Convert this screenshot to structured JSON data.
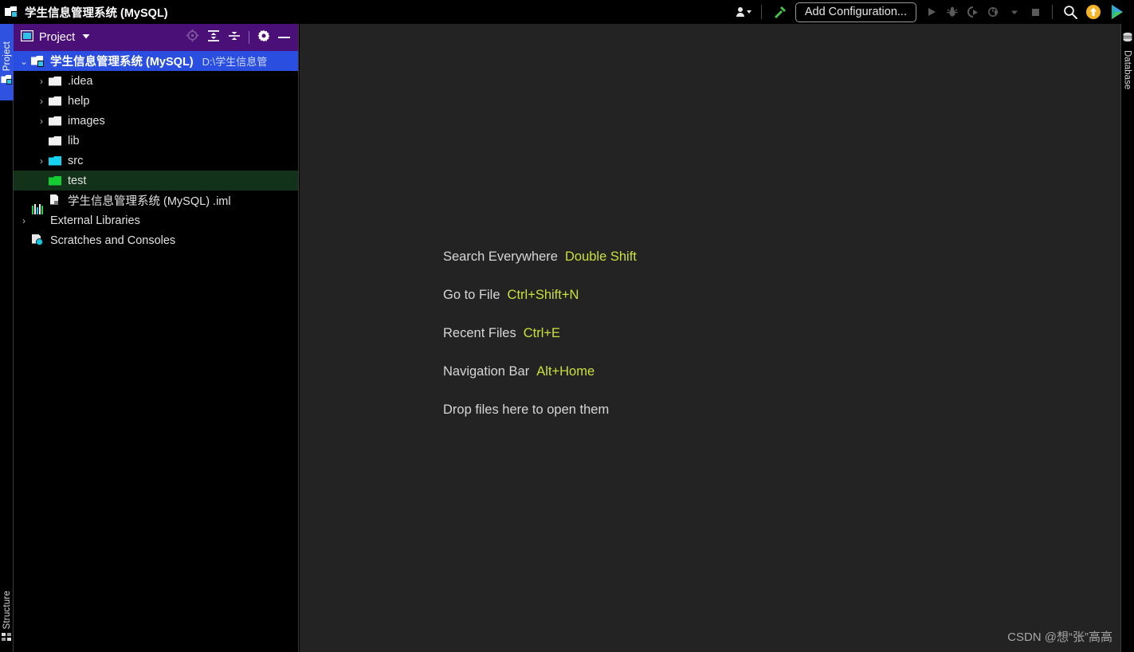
{
  "window": {
    "title": "学生信息管理系统 (MySQL)",
    "title_icon": "project-folder-icon"
  },
  "toolbar": {
    "user_icon": "user-avatar-icon",
    "user_dropdown_icon": "chevron-down-icon",
    "build_icon": "hammer-icon",
    "add_configuration_label": "Add Configuration...",
    "run_icon": "run-play-icon",
    "debug_icon": "debug-bug-icon",
    "run_coverage_icon": "run-with-coverage-icon",
    "profiler_icon": "profiler-icon",
    "profiler_dropdown_icon": "chevron-down-icon",
    "stop_icon": "stop-square-icon",
    "search_icon": "search-icon",
    "update_icon": "update-arrow-icon",
    "app_logo_icon": "ide-logo-icon"
  },
  "left_strip": {
    "tabs": [
      {
        "label": "Project",
        "icon": "project-folder-icon",
        "active": true
      },
      {
        "label": "Structure",
        "icon": "structure-icon",
        "active": false
      }
    ]
  },
  "right_strip": {
    "tabs": [
      {
        "label": "Database",
        "icon": "database-cylinder-icon",
        "active": false
      }
    ]
  },
  "project_panel": {
    "title": "Project",
    "title_icon": "project-view-icon",
    "dropdown_icon": "chevron-down-icon",
    "actions": [
      {
        "name": "locate-icon",
        "label": ""
      },
      {
        "name": "expand-all-icon",
        "label": ""
      },
      {
        "name": "collapse-all-icon",
        "label": ""
      },
      {
        "name": "settings-gear-icon",
        "label": ""
      },
      {
        "name": "hide-minimize-icon",
        "label": ""
      }
    ],
    "tree": [
      {
        "label": "学生信息管理系统 (MySQL)",
        "path": "D:\\学生信息管",
        "icon": "project-folder-icon",
        "chevron": "open",
        "selected": true,
        "indent": 0
      },
      {
        "label": ".idea",
        "path": "",
        "icon": "folder-white-icon",
        "chevron": "closed",
        "selected": false,
        "indent": 1
      },
      {
        "label": "help",
        "path": "",
        "icon": "folder-white-icon",
        "chevron": "closed",
        "selected": false,
        "indent": 1
      },
      {
        "label": "images",
        "path": "",
        "icon": "folder-white-icon",
        "chevron": "closed",
        "selected": false,
        "indent": 1
      },
      {
        "label": "lib",
        "path": "",
        "icon": "folder-white-icon",
        "chevron": "none",
        "selected": false,
        "indent": 1
      },
      {
        "label": "src",
        "path": "",
        "icon": "folder-source-cyan-icon",
        "chevron": "closed",
        "selected": false,
        "indent": 1
      },
      {
        "label": "test",
        "path": "",
        "icon": "folder-test-green-icon",
        "chevron": "none",
        "selected": false,
        "indent": 1,
        "highlight": "test"
      },
      {
        "label": "学生信息管理系统 (MySQL) .iml",
        "path": "",
        "icon": "module-iml-icon",
        "chevron": "none",
        "selected": false,
        "indent": 1
      },
      {
        "label": "External Libraries",
        "path": "",
        "icon": "external-libraries-icon",
        "chevron": "closed",
        "selected": false,
        "indent": 0
      },
      {
        "label": "Scratches and Consoles",
        "path": "",
        "icon": "scratches-icon",
        "chevron": "none",
        "selected": false,
        "indent": 0
      }
    ]
  },
  "editor": {
    "hints": [
      {
        "action": "Search Everywhere",
        "shortcut": "Double Shift"
      },
      {
        "action": "Go to File",
        "shortcut": "Ctrl+Shift+N"
      },
      {
        "action": "Recent Files",
        "shortcut": "Ctrl+E"
      },
      {
        "action": "Navigation Bar",
        "shortcut": "Alt+Home"
      },
      {
        "action": "Drop files here to open them",
        "shortcut": ""
      }
    ],
    "watermark": "CSDN @想“张”高高"
  },
  "colors": {
    "panel_header": "#4b0f78",
    "selection_blue": "#2a4fe0",
    "test_row_green": "#12321a",
    "shortcut_yellow_green": "#c9e03b",
    "editor_bg": "#232323",
    "accent_cyan": "#16d3f2"
  }
}
